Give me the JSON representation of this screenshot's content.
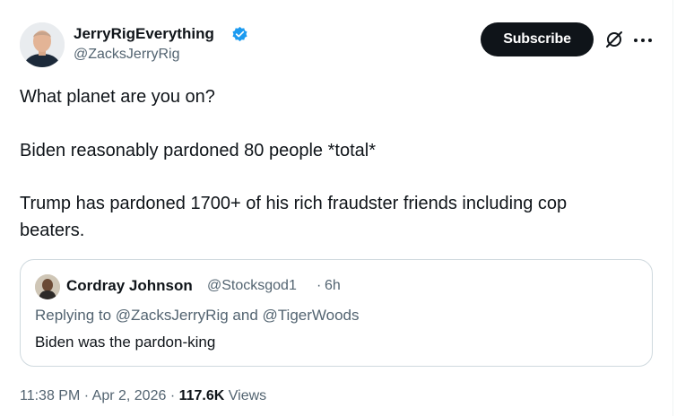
{
  "author": {
    "name": "JerryRigEverything",
    "handle": "@ZacksJerryRig",
    "verified_color": "#1d9bf0"
  },
  "actions": {
    "subscribe_label": "Subscribe",
    "grok_icon": "grok-slash-circle-icon",
    "more_icon": "more-horizontal-icon"
  },
  "tweet": {
    "lines": [
      "What planet are you on?",
      "Biden reasonably pardoned 80 people *total*",
      "Trump has pardoned 1700+ of his rich fraudster friends including cop",
      "beaters."
    ]
  },
  "quote": {
    "name": "Cordray Johnson",
    "handle": "@Stocksgod1",
    "separator": "·",
    "time": "6h",
    "reply_prefix": "Replying to",
    "reply_user1": "@ZacksJerryRig",
    "reply_and": "and",
    "reply_user2": "@TigerWoods",
    "text": "Biden was the pardon-king"
  },
  "meta": {
    "time": "11:38 PM",
    "separator": "·",
    "date": "Apr 2, 2026",
    "views_count": "117.6K",
    "views_label": "Views"
  },
  "colors": {
    "text": "#0f1419",
    "secondary": "#536471",
    "link": "#1d9bf0",
    "border": "#cfd9de"
  }
}
